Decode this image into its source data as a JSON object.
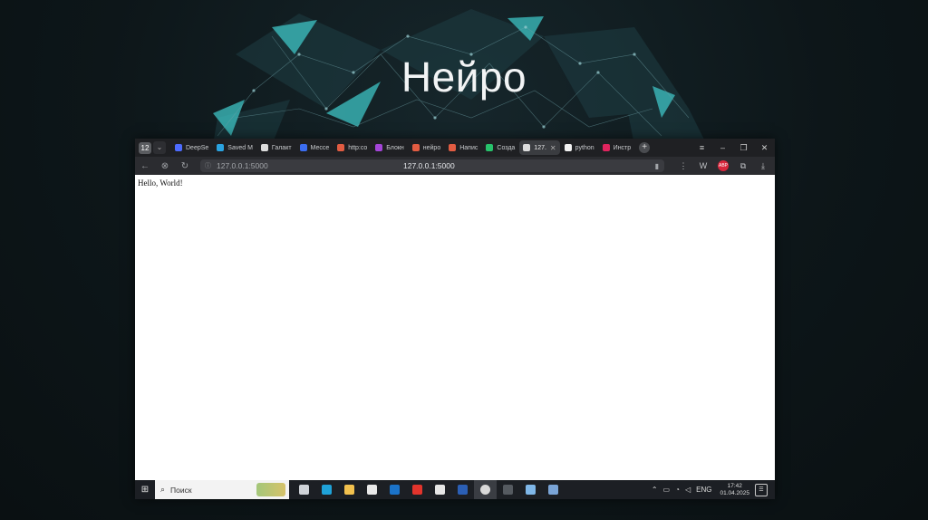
{
  "slide": {
    "title": "Нейро"
  },
  "browser": {
    "tab_count": "12",
    "tabs": [
      {
        "label": "DeepSe",
        "color": "#4d6bfe"
      },
      {
        "label": "Saved M",
        "color": "#2aa3e0"
      },
      {
        "label": "Галакт",
        "color": "#dcdcdc"
      },
      {
        "label": "Мессе",
        "color": "#3b6df0"
      },
      {
        "label": "http:co",
        "color": "#e25c42"
      },
      {
        "label": "Блокн",
        "color": "#a445d8"
      },
      {
        "label": "нейро",
        "color": "#e25c42"
      },
      {
        "label": "Напис",
        "color": "#e25c42"
      },
      {
        "label": "Созда",
        "color": "#27c26b"
      },
      {
        "label": "127.",
        "color": "#dcdcdc",
        "active": true
      },
      {
        "label": "python",
        "color": "#f2f2f2"
      },
      {
        "label": "Инстр",
        "color": "#e0245e"
      }
    ],
    "address": {
      "left": "127.0.0.1:5000",
      "center": "127.0.0.1:5000"
    },
    "abp_label": "ABP",
    "page_text": "Hello, World!"
  },
  "taskbar": {
    "search_placeholder": "Поиск",
    "apps": [
      {
        "name": "task-view",
        "color": "#cfd3d8"
      },
      {
        "name": "edge",
        "color": "#1fa2d8"
      },
      {
        "name": "file-explorer",
        "color": "#f2c14e"
      },
      {
        "name": "store",
        "color": "#e9e9e9"
      },
      {
        "name": "outlook",
        "color": "#1b73c9"
      },
      {
        "name": "yandex",
        "color": "#e2342c"
      },
      {
        "name": "app-doc",
        "color": "#e6e6e6"
      },
      {
        "name": "word",
        "color": "#2b5fb5"
      },
      {
        "name": "yandex-browser",
        "color": "#d9d9d9",
        "active": true
      },
      {
        "name": "terminal",
        "color": "#555a60"
      },
      {
        "name": "app-blue",
        "color": "#7fb7e8"
      },
      {
        "name": "app-python",
        "color": "#7aa4d6"
      }
    ],
    "lang": "ENG",
    "time": "17:42",
    "date": "01.04.2025"
  }
}
